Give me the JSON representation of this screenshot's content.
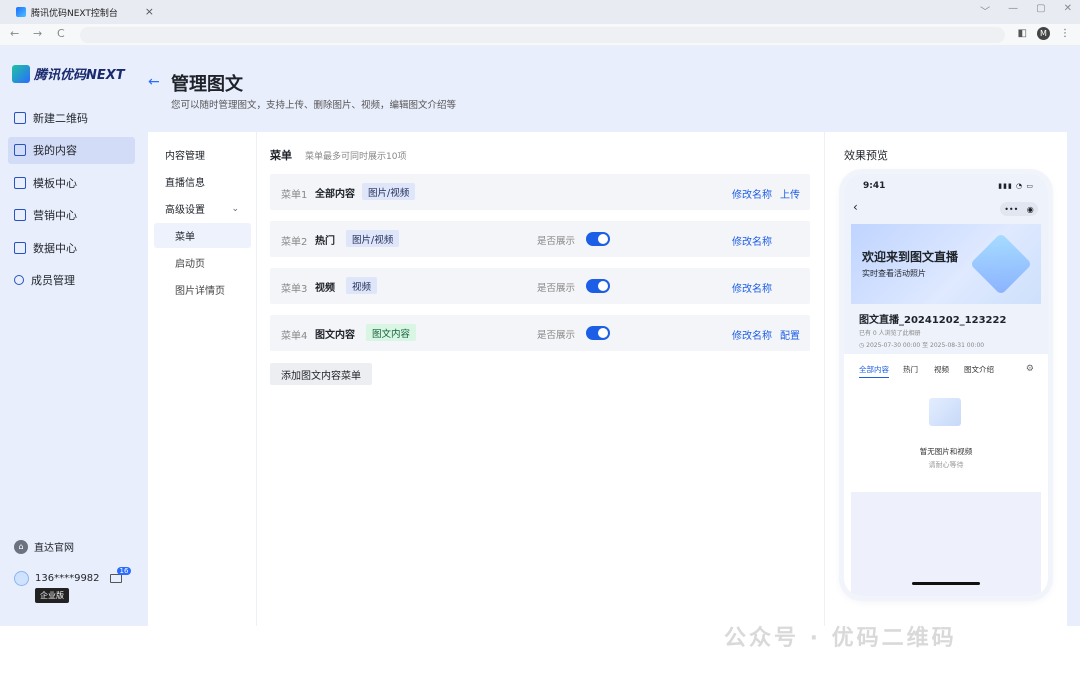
{
  "browser": {
    "tab_title": "腾讯优码NEXT控制台",
    "tab_close": "×",
    "min": "﹀",
    "minimize": "—",
    "restore": "▢",
    "close": "✕",
    "back": "←",
    "forward": "→",
    "reload": "C",
    "profile": "M",
    "menu": "⋮",
    "side": "◧"
  },
  "brand": {
    "logo_text": "腾讯优码NEXT"
  },
  "sidebar": {
    "items": [
      {
        "label": "新建二维码"
      },
      {
        "label": "我的内容"
      },
      {
        "label": "模板中心"
      },
      {
        "label": "营销中心"
      },
      {
        "label": "数据中心"
      },
      {
        "label": "成员管理"
      }
    ],
    "official_site": "直达官网",
    "user_phone": "136****9982",
    "msg_count": "16",
    "edition": "企业版"
  },
  "header": {
    "back_arrow": "←",
    "title": "管理图文",
    "subtitle": "您可以随时管理图文，支持上传、删除图片、视频，编辑图文介绍等"
  },
  "subnav": {
    "items": [
      "内容管理",
      "直播信息",
      "高级设置"
    ],
    "children": [
      "菜单",
      "启动页",
      "图片详情页"
    ],
    "chevron": "⌄"
  },
  "menu_section": {
    "title": "菜单",
    "note": "菜单最多可同时展示10项",
    "show_label": "是否展示",
    "rows": [
      {
        "num": "菜单1",
        "name": "全部内容",
        "tag": "图片/视频",
        "links": [
          "修改名称",
          "上传"
        ]
      },
      {
        "num": "菜单2",
        "name": "热门",
        "tag": "图片/视频",
        "links": [
          "修改名称"
        ]
      },
      {
        "num": "菜单3",
        "name": "视频",
        "tag": "视频",
        "links": [
          "修改名称"
        ]
      },
      {
        "num": "菜单4",
        "name": "图文内容",
        "tag": "图文内容",
        "links": [
          "修改名称",
          "配置"
        ]
      }
    ],
    "add_button": "添加图文内容菜单"
  },
  "preview": {
    "title": "效果预览",
    "time": "9:41",
    "signal": "▮▮▮ ◔ ▭",
    "capsule_dots": "•••",
    "capsule_target": "◉",
    "back": "‹",
    "banner_title": "欢迎来到图文直播",
    "banner_sub": "实时查看活动照片",
    "live_title": "图文直播_20241202_123222",
    "meta1": "已有 0 人浏览了此相册",
    "meta2": "◷ 2025-07-30 00:00 至 2025-08-31 00:00",
    "tabs": [
      "全部内容",
      "热门",
      "视频",
      "图文介绍"
    ],
    "settings": "⚙",
    "empty_title": "暂无图片和视频",
    "empty_sub": "请耐心等待"
  },
  "watermark": "公众号 · 优码二维码",
  "colors": {
    "accent": "#1d5ee6",
    "app_bg": "#e9eefc",
    "active_nav": "#d3dcf7",
    "tag_blue": "#dfe6f9",
    "tag_green": "#d9f5e3"
  }
}
